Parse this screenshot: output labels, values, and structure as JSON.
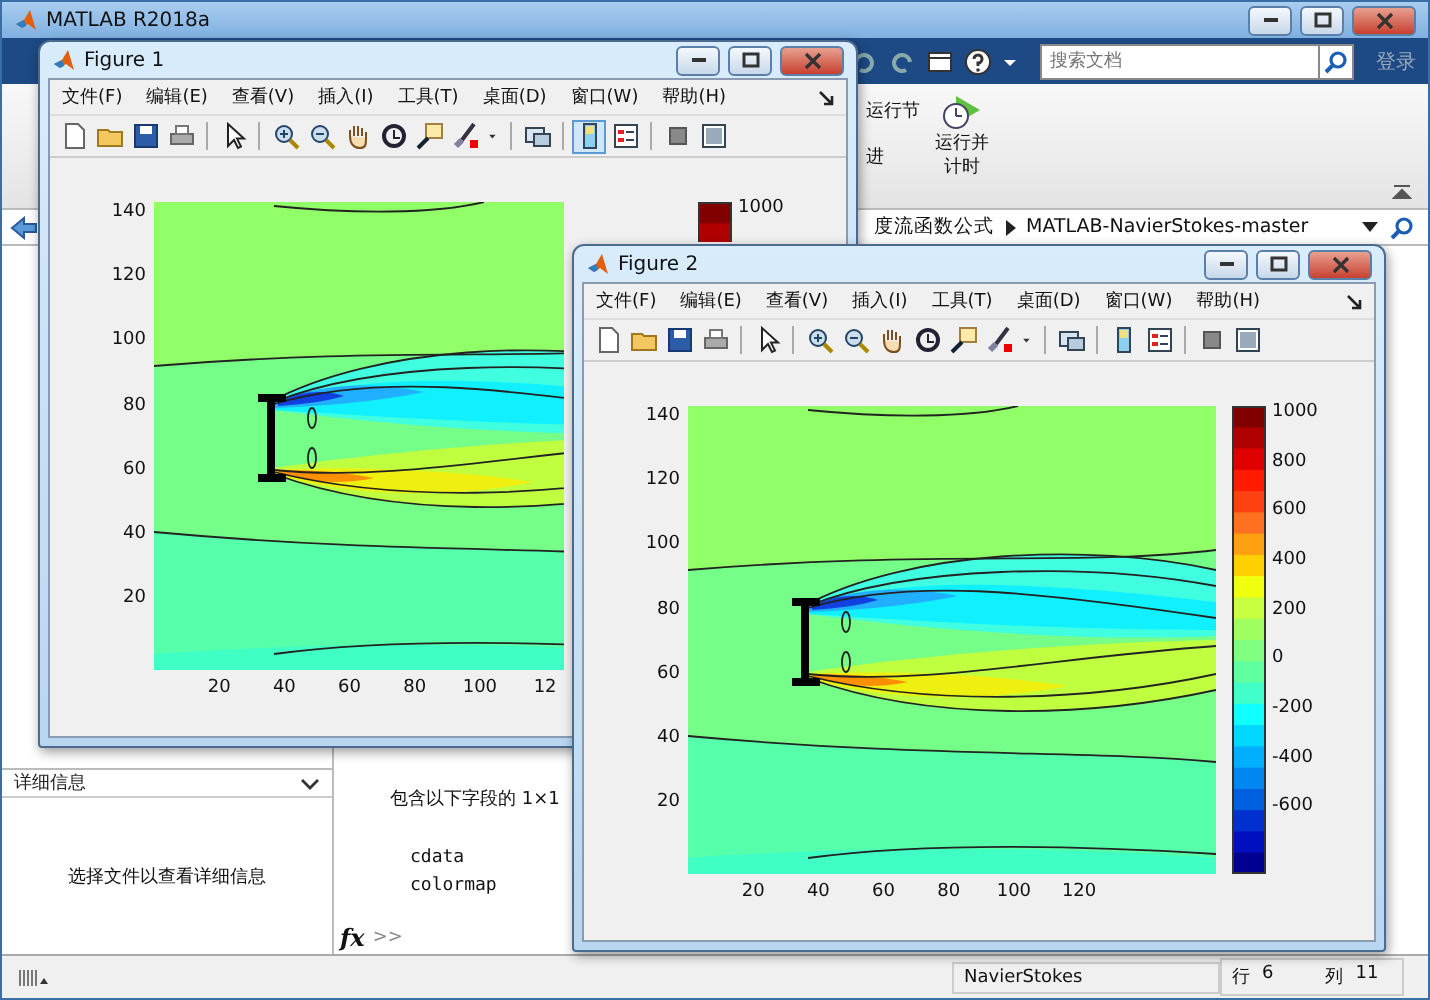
{
  "main_window": {
    "title": "MATLAB R2018a"
  },
  "search": {
    "placeholder": "搜索文档"
  },
  "login": "登录",
  "ribbon": {
    "run_section": "运行节",
    "advance": "进",
    "run_and_time": "运行并计时"
  },
  "path": [
    "度流函数公式",
    "MATLAB-NavierStokes-master"
  ],
  "details": {
    "title": "详细信息",
    "message": "选择文件以查看详细信息"
  },
  "command_window": {
    "lines": [
      "包含以下字段的 1×1",
      "cdata",
      "colormap"
    ],
    "fx": "fx",
    "prompt": ">>"
  },
  "status_bar": {
    "file": "NavierStokes",
    "row_label": "行",
    "row": "6",
    "col_label": "列",
    "col": "11"
  },
  "figures": [
    {
      "title": "Figure 1",
      "menu": [
        "文件(F)",
        "编辑(E)",
        "查看(V)",
        "插入(I)",
        "工具(T)",
        "桌面(D)",
        "窗口(W)",
        "帮助(H)"
      ],
      "colorbar_button_pressed": true,
      "y_ticks": [
        "140",
        "120",
        "100",
        "80",
        "60",
        "40",
        "20"
      ],
      "x_ticks": [
        "20",
        "40",
        "60",
        "80",
        "100",
        "12"
      ],
      "colorbar_ticks": [
        "1000"
      ]
    },
    {
      "title": "Figure 2",
      "menu": [
        "文件(F)",
        "编辑(E)",
        "查看(V)",
        "插入(I)",
        "工具(T)",
        "桌面(D)",
        "窗口(W)",
        "帮助(H)"
      ],
      "colorbar_button_pressed": false,
      "y_ticks": [
        "140",
        "120",
        "100",
        "80",
        "60",
        "40",
        "20"
      ],
      "x_ticks": [
        "20",
        "40",
        "60",
        "80",
        "100",
        "120"
      ],
      "colorbar_ticks": [
        "1000",
        "800",
        "600",
        "400",
        "200",
        "0",
        "-200",
        "-400",
        "-600"
      ]
    }
  ]
}
